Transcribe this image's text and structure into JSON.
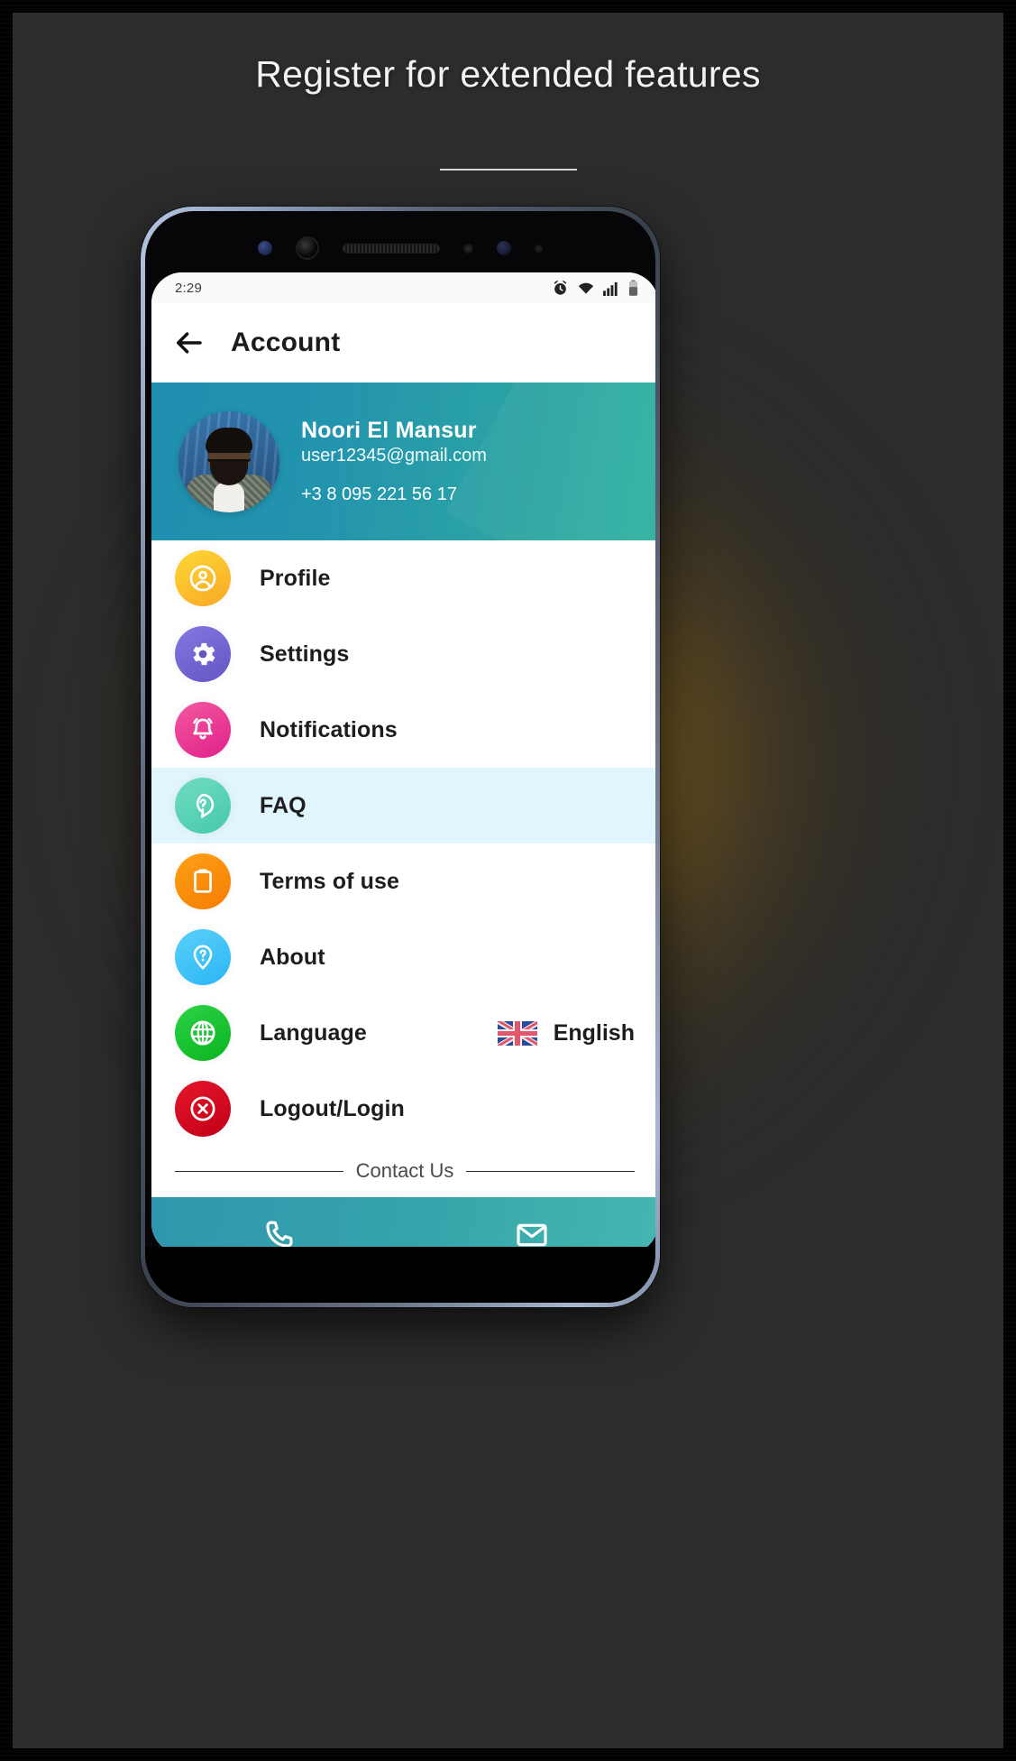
{
  "page": {
    "headline": "Register for extended features"
  },
  "phone": {
    "status": {
      "time": "2:29",
      "icons": [
        "alarm-icon",
        "wifi-icon",
        "signal-icon",
        "battery-icon"
      ]
    },
    "appbar": {
      "back_icon": "arrow-left-icon",
      "title": "Account"
    },
    "profile": {
      "name": "Noori El Mansur",
      "email": "user12345@gmail.com",
      "phone": "+3 8 095 221 56 17",
      "avatar_alt": "user-photo",
      "gradient_from": "#1f8fb0",
      "gradient_to": "#31b2a0"
    },
    "menu": [
      {
        "label": "Profile",
        "icon": "person-circle-icon",
        "color_from": "#fdd835",
        "color_to": "#f9a825",
        "active": false
      },
      {
        "label": "Settings",
        "icon": "gear-icon",
        "color_from": "#7b6fd6",
        "color_to": "#6355c4",
        "active": false
      },
      {
        "label": "Notifications",
        "icon": "bell-icon",
        "color_from": "#f0529e",
        "color_to": "#e0218a",
        "active": false
      },
      {
        "label": "FAQ",
        "icon": "question-bubble-icon",
        "color_from": "#6ed8bd",
        "color_to": "#45c9ac",
        "active": true
      },
      {
        "label": "Terms of use",
        "icon": "clipboard-icon",
        "color_from": "#ffa117",
        "color_to": "#f57c00",
        "active": false
      },
      {
        "label": "About",
        "icon": "pin-question-icon",
        "color_from": "#53ccf7",
        "color_to": "#29b6f6",
        "active": false
      },
      {
        "label": "Language",
        "icon": "globe-icon",
        "color_from": "#22c63c",
        "color_to": "#0bb41f",
        "active": false,
        "value": "English",
        "value_icon": "uk-flag-icon"
      },
      {
        "label": "Logout/Login",
        "icon": "close-circle-icon",
        "color_from": "#e6162b",
        "color_to": "#c00016",
        "active": false
      }
    ],
    "contact": {
      "label": "Contact Us"
    },
    "footer": {
      "buttons": [
        {
          "icon": "phone-icon",
          "name": "call-button"
        },
        {
          "icon": "mail-icon",
          "name": "email-button"
        }
      ]
    }
  }
}
